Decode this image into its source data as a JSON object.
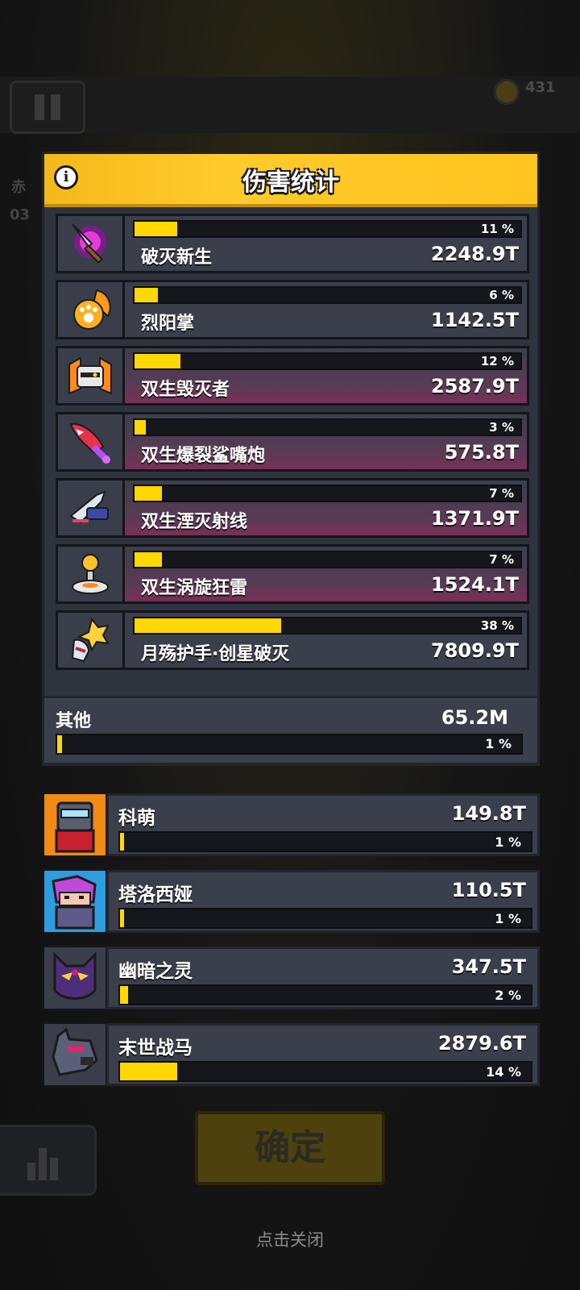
{
  "background": {
    "coin_count": "431",
    "left_text": "赤",
    "left_num": "03"
  },
  "panel": {
    "title": "伤害统计",
    "info_icon": "info-icon"
  },
  "weapons": [
    {
      "name": "破灭新生",
      "percent_text": "11 %",
      "percent": 11,
      "value": "2248.9T",
      "twin": false,
      "icon": "magenta-spear-icon"
    },
    {
      "name": "烈阳掌",
      "percent_text": "6 %",
      "percent": 6,
      "value": "1142.5T",
      "twin": false,
      "icon": "fire-paw-icon"
    },
    {
      "name": "双生毁灭者",
      "percent_text": "12 %",
      "percent": 12,
      "value": "2587.9T",
      "twin": true,
      "icon": "destroyer-drone-icon"
    },
    {
      "name": "双生爆裂鲨嘴炮",
      "percent_text": "3 %",
      "percent": 3,
      "value": "575.8T",
      "twin": true,
      "icon": "shark-rocket-icon"
    },
    {
      "name": "双生湮灭射线",
      "percent_text": "7 %",
      "percent": 7,
      "value": "1371.9T",
      "twin": true,
      "icon": "ray-ship-icon"
    },
    {
      "name": "双生涡旋狂雷",
      "percent_text": "7 %",
      "percent": 7,
      "value": "1524.1T",
      "twin": true,
      "icon": "thunder-orb-icon"
    },
    {
      "name": "月殇护手·创星破灭",
      "percent_text": "38 %",
      "percent": 38,
      "value": "7809.9T",
      "twin": false,
      "icon": "gauntlet-icon"
    }
  ],
  "other": {
    "label": "其他",
    "value": "65.2M",
    "percent_text": "1 %",
    "percent": 1
  },
  "heroes": [
    {
      "name": "科萌",
      "value": "149.8T",
      "percent_text": "1 %",
      "percent": 1,
      "avatar_bg": "#f28a16",
      "icon": "knight-hero-icon"
    },
    {
      "name": "塔洛西娅",
      "value": "110.5T",
      "percent_text": "1 %",
      "percent": 1,
      "avatar_bg": "#2e9de0",
      "icon": "ninja-hero-icon"
    },
    {
      "name": "幽暗之灵",
      "value": "347.5T",
      "percent_text": "2 %",
      "percent": 2,
      "avatar_bg": "#3a3e4b",
      "icon": "shadow-spirit-icon"
    },
    {
      "name": "末世战马",
      "value": "2879.6T",
      "percent_text": "14 %",
      "percent": 14,
      "avatar_bg": "#3a3e4b",
      "icon": "war-horse-icon"
    }
  ],
  "buttons": {
    "confirm": "确定",
    "close_hint": "点击关闭"
  },
  "colors": {
    "accent": "#ffd800",
    "header": "#ffc41f",
    "panel": "#2f333d"
  }
}
